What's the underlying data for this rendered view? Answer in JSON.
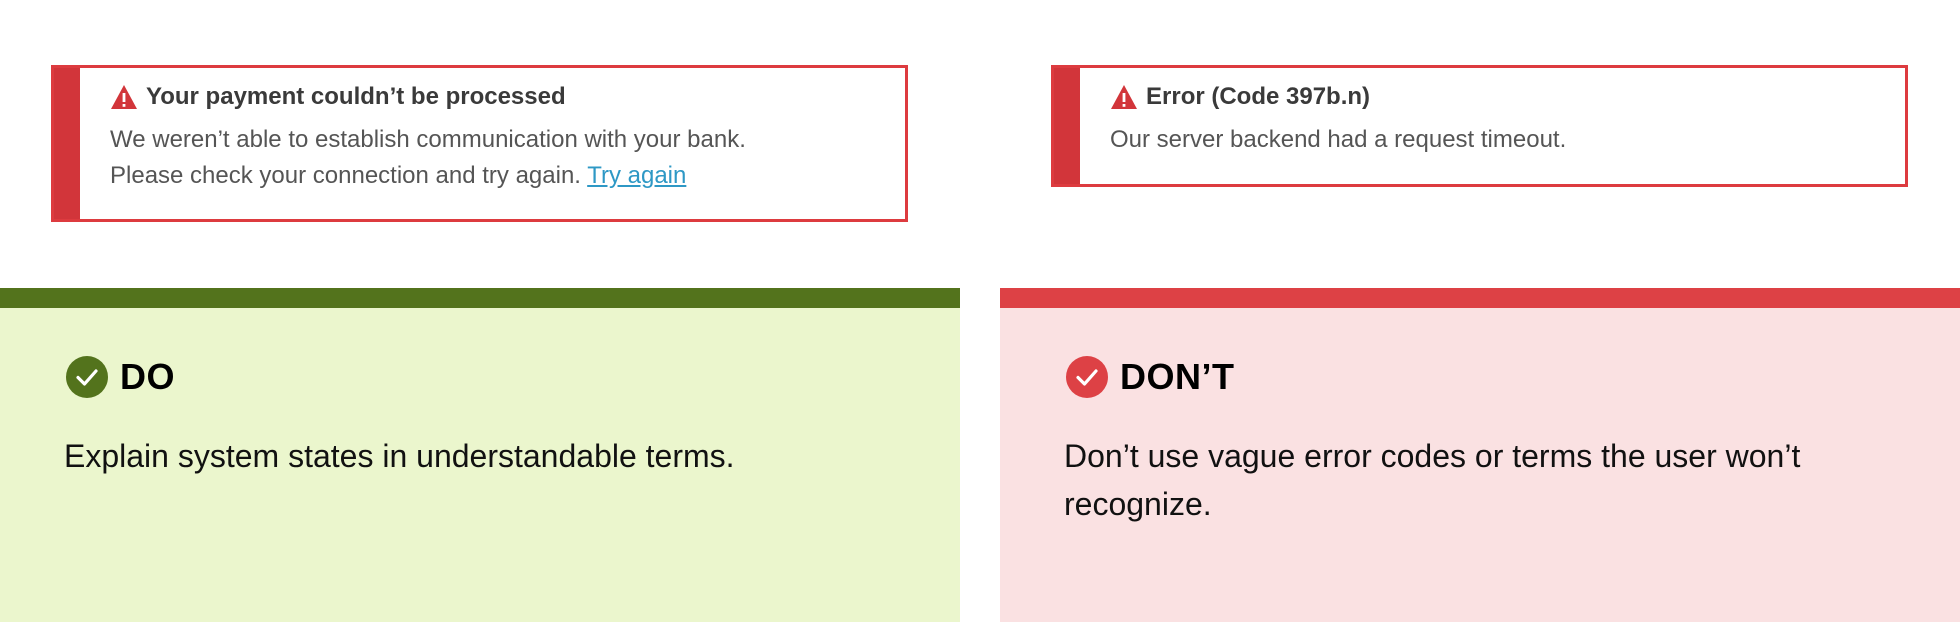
{
  "alerts": {
    "payment": {
      "title": "Your payment couldn’t be processed",
      "line1": "We weren’t able to establish communication with your bank.",
      "line2": "Please check your connection and try again.",
      "link": "Try again"
    },
    "error": {
      "title": "Error (Code 397b.n)",
      "body": "Our server backend had a request timeout."
    }
  },
  "do": {
    "label": "DO",
    "text": "Explain system states in understandable terms.",
    "icon": "check-circle-icon",
    "color": "#53731c"
  },
  "dont": {
    "label": "DON’T",
    "text": "Don’t use vague error codes or terms the user won’t recognize.",
    "icon": "check-circle-icon",
    "color": "#dd4145"
  },
  "colors": {
    "alert_border": "#dd3b3f",
    "link": "#2e98c5",
    "do_bg": "#ebf6cd",
    "dont_bg": "#fae1e2"
  }
}
